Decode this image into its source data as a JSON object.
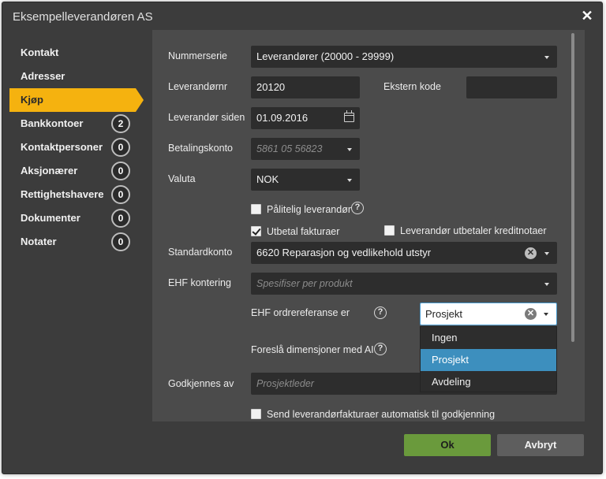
{
  "window": {
    "title": "Eksempelleverandøren AS"
  },
  "sidebar": {
    "items": [
      {
        "label": "Kontakt",
        "count": null
      },
      {
        "label": "Adresser",
        "count": null
      },
      {
        "label": "Kjøp",
        "count": null
      },
      {
        "label": "Bankkontoer",
        "count": "2"
      },
      {
        "label": "Kontaktpersoner",
        "count": "0"
      },
      {
        "label": "Aksjonærer",
        "count": "0"
      },
      {
        "label": "Rettighetshavere",
        "count": "0"
      },
      {
        "label": "Dokumenter",
        "count": "0"
      },
      {
        "label": "Notater",
        "count": "0"
      }
    ],
    "active": "Kjøp"
  },
  "form": {
    "nummerserie": {
      "label": "Nummerserie",
      "value": "Leverandører (20000 - 29999)"
    },
    "leverandornr": {
      "label": "Leverandørnr",
      "value": "20120"
    },
    "ekstern_kode": {
      "label": "Ekstern kode",
      "value": ""
    },
    "leverandor_siden": {
      "label": "Leverandør siden",
      "value": "01.09.2016"
    },
    "betalingskonto": {
      "label": "Betalingskonto",
      "placeholder": "5861 05 56823"
    },
    "valuta": {
      "label": "Valuta",
      "value": "NOK"
    },
    "palitelig": {
      "label": "Pålitelig leverandør",
      "checked": false
    },
    "utbetal": {
      "label": "Utbetal fakturaer",
      "checked": true
    },
    "kreditnotaer": {
      "label": "Leverandør utbetaler kreditnotaer",
      "checked": false
    },
    "standardkonto": {
      "label": "Standardkonto",
      "value": "6620 Reparasjon og vedlikehold utstyr"
    },
    "ehf_kontering": {
      "label": "EHF kontering",
      "placeholder": "Spesifiser per produkt"
    },
    "ehf_ordreref": {
      "label": "EHF ordrereferanse er",
      "value": "Prosjekt",
      "options": [
        "Ingen",
        "Prosjekt",
        "Avdeling"
      ],
      "selected": "Prosjekt"
    },
    "foresla": {
      "label": "Foreslå dimensjoner med AI"
    },
    "godkjennes": {
      "label": "Godkjennes av",
      "placeholder": "Prosjektleder"
    },
    "send_auto": {
      "label": "Send leverandørfakturaer automatisk til godkjenning",
      "checked": false
    }
  },
  "footer": {
    "ok_label": "Ok",
    "cancel_label": "Avbryt"
  },
  "colors": {
    "accent": "#f5b20f",
    "ok": "#6a9a3c",
    "selected_option": "#3d8fbe"
  }
}
